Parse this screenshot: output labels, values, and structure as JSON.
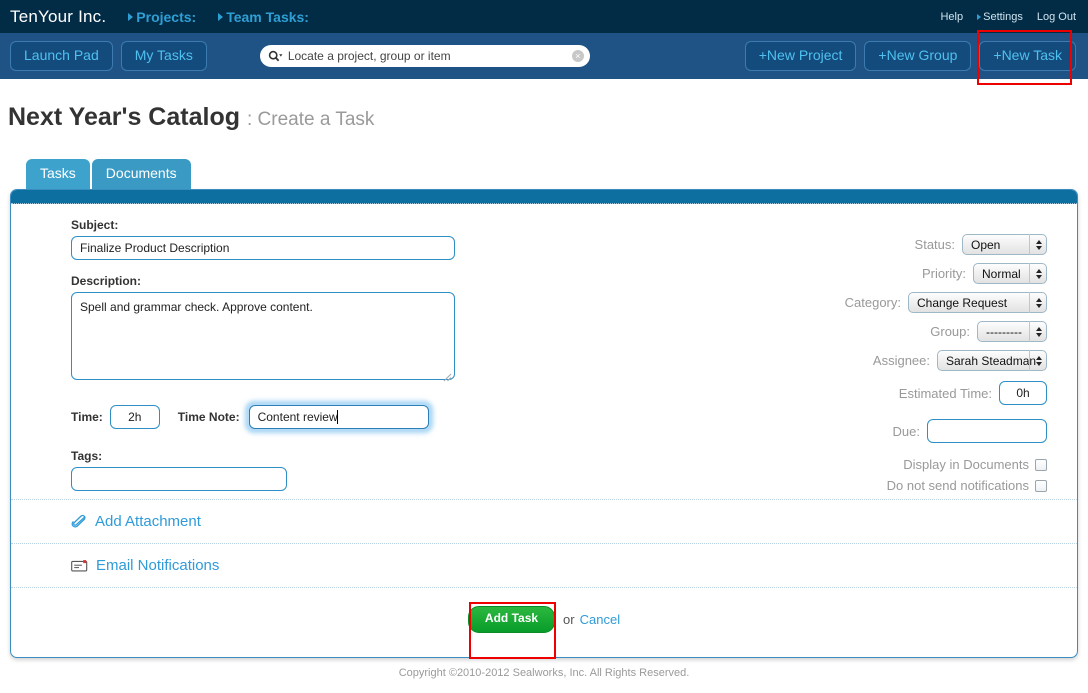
{
  "topbar": {
    "brand": "TenYour Inc.",
    "nav": [
      {
        "label": "Projects:",
        "icon": "triangle-right-icon"
      },
      {
        "label": "Team Tasks:",
        "icon": "triangle-right-icon"
      }
    ],
    "help": "Help",
    "settings": "Settings",
    "logout": "Log Out"
  },
  "navbar": {
    "launch_pad": "Launch Pad",
    "my_tasks": "My Tasks",
    "search": {
      "placeholder": "Locate a project, group or item",
      "value": "",
      "icon": "search-icon",
      "clear_icon": "clear-circle-icon",
      "clear_glyph": "×"
    },
    "new_project": "+New Project",
    "new_group": "+New Group",
    "new_task": "+New Task"
  },
  "page": {
    "title": "Next Year's Catalog",
    "subtitle": ": Create a Task"
  },
  "tabs": [
    {
      "label": "Tasks",
      "active": true
    },
    {
      "label": "Documents",
      "active": false
    }
  ],
  "form": {
    "subject": {
      "label": "Subject:",
      "value": "Finalize Product Description",
      "placeholder": ""
    },
    "description": {
      "label": "Description:",
      "value": "Spell and grammar check. Approve content.",
      "placeholder": ""
    },
    "time": {
      "label": "Time:",
      "value": "2h",
      "placeholder": ""
    },
    "time_note": {
      "label": "Time Note:",
      "value": "Content review",
      "placeholder": "",
      "focused": true
    },
    "tags": {
      "label": "Tags:",
      "value": "",
      "placeholder": ""
    },
    "status": {
      "label": "Status:",
      "value": "Open"
    },
    "priority": {
      "label": "Priority:",
      "value": "Normal"
    },
    "category": {
      "label": "Category:",
      "value": "Change Request"
    },
    "group": {
      "label": "Group:",
      "value": "---------"
    },
    "assignee": {
      "label": "Assignee:",
      "value": "Sarah Steadman"
    },
    "estimated_time": {
      "label": "Estimated Time:",
      "value": "0h",
      "placeholder": ""
    },
    "due": {
      "label": "Due:",
      "value": "",
      "placeholder": ""
    },
    "display_in_documents": {
      "label": "Display in Documents",
      "checked": false
    },
    "do_not_send_notifications": {
      "label": "Do not send notifications",
      "checked": false
    }
  },
  "links": {
    "add_attachment": {
      "label": "Add Attachment",
      "icon": "paperclip-icon"
    },
    "email_notifications": {
      "label": "Email Notifications",
      "icon": "envelope-icon"
    }
  },
  "submit": {
    "add_task": "Add Task",
    "or": "or",
    "cancel": "Cancel"
  },
  "footer": {
    "copyright": "Copyright ©2010-2012 Sealworks, Inc. All Rights Reserved."
  },
  "colors": {
    "topbar_bg": "#022c46",
    "navbar_bg": "#1f5386",
    "tab_bg": "#3a9ac4",
    "panel_head_bg": "#0d6ea0",
    "link_blue": "#2f9bd8",
    "accent_cyan": "#2e9fd4",
    "add_button_green": "#089c2a",
    "highlight_red": "#ee0000",
    "input_border": "#2f8fc4"
  }
}
